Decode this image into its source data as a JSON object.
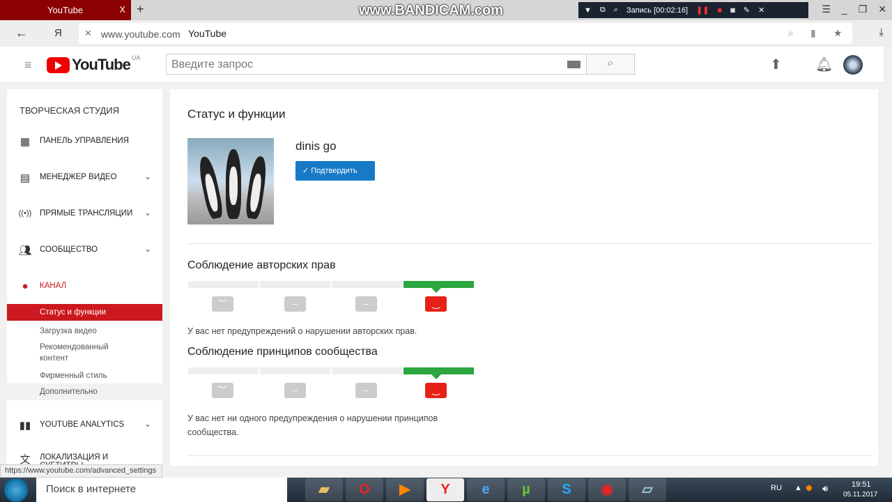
{
  "browser": {
    "tab_title": "YouTube",
    "tab_close": "X",
    "new_tab": "+",
    "url": "www.youtube.com",
    "page_title": "YouTube",
    "back": "←",
    "yandex": "Я",
    "stop": "✕"
  },
  "recorder": {
    "watermark": "www.BANDICAM.com",
    "record_label": "Запись [00:02:16]"
  },
  "header": {
    "logo_text": "YouTube",
    "region": "UA",
    "search_placeholder": "Введите запрос"
  },
  "sidebar": {
    "title": "ТВОРЧЕСКАЯ СТУДИЯ",
    "items": [
      {
        "label": "ПАНЕЛЬ УПРАВЛЕНИЯ",
        "icon": "dashboard-icon"
      },
      {
        "label": "МЕНЕДЖЕР ВИДЕО",
        "icon": "video-manager-icon"
      },
      {
        "label": "ПРЯМЫЕ ТРАНСЛЯЦИИ",
        "icon": "live-icon"
      },
      {
        "label": "СООБЩЕСТВО",
        "icon": "community-icon"
      },
      {
        "label": "КАНАЛ",
        "icon": "channel-icon"
      }
    ],
    "channel_sub": [
      "Статус и функции",
      "Загрузка видео",
      "Рекомендованный контент",
      "Фирменный стиль",
      "Дополнительно"
    ],
    "analytics": "YOUTUBE ANALYTICS",
    "localization": "ЛОКАЛИЗАЦИЯ И СУБТИТРЫ"
  },
  "main": {
    "title": "Статус и функции",
    "channel_name": "dinis go",
    "verify_button": "Подтвердить",
    "copyright": {
      "title": "Соблюдение авторских прав",
      "message": "У вас нет предупреждений о нарушении авторских прав.",
      "level": 4,
      "of": 4
    },
    "community": {
      "title": "Соблюдение принципов сообщества",
      "message": "У вас нет ни одного предупреждения о нарушении принципов сообщества.",
      "level": 4,
      "of": 4
    }
  },
  "status_url": "https://www.youtube.com/advanced_settings",
  "taskbar": {
    "search": "Поиск в интернете",
    "lang": "RU",
    "time": "19:51",
    "date": "05.11.2017"
  },
  "colors": {
    "accent": "#cc181e",
    "verify": "#167ac6",
    "good": "#2ba640"
  }
}
